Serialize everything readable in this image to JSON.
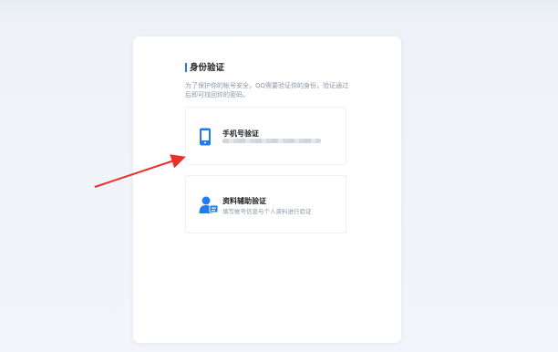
{
  "card": {
    "title": "身份验证",
    "description": "为了保护你的帐号安全，QQ需要验证你的身份，验证通过后即可找回你的密码。"
  },
  "options": [
    {
      "title": "手机号验证",
      "subtitle": "",
      "icon": "phone-icon"
    },
    {
      "title": "资料辅助验证",
      "subtitle": "填写帐号信息与个人资料进行验证",
      "icon": "user-id-icon"
    }
  ],
  "colors": {
    "accent": "#1f7cf2",
    "arrow": "#e8312a"
  }
}
